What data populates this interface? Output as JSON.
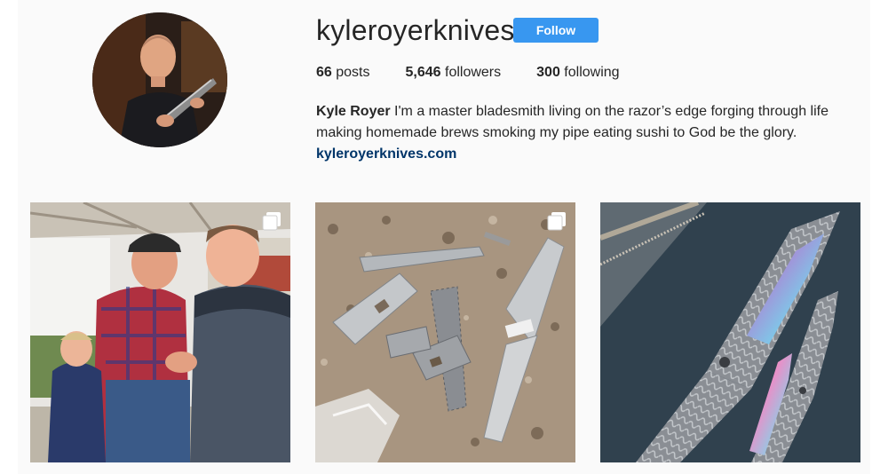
{
  "profile": {
    "username": "kyleroyerknives",
    "follow_label": "Follow",
    "avatar_icon": "avatar-photo",
    "stats": {
      "posts_count": "66",
      "posts_label": "posts",
      "followers_count": "5,646",
      "followers_label": "followers",
      "following_count": "300",
      "following_label": "following"
    },
    "bio": {
      "name": "Kyle Royer",
      "text": "I'm a master bladesmith living on the razor’s edge forging through life making homemade brews smoking my pipe eating sushi to God be the glory.",
      "link": "kyleroyerknives.com"
    }
  },
  "posts": [
    {
      "icon": "multiple-photos-icon"
    },
    {
      "icon": "multiple-photos-icon"
    },
    {
      "icon": ""
    }
  ],
  "colors": {
    "follow_button": "#3897f0",
    "link": "#003569",
    "page_background": "#fafafa"
  }
}
